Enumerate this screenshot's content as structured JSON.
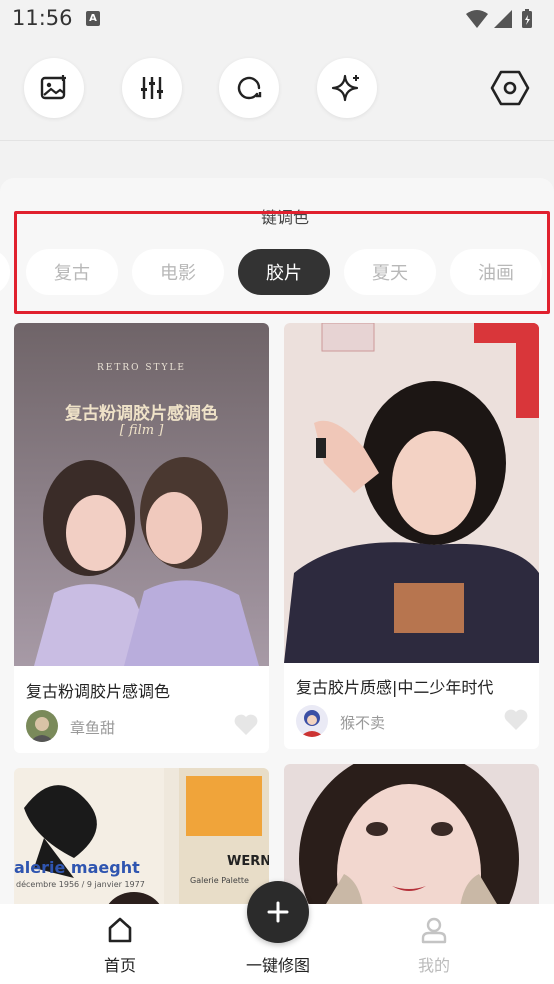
{
  "status_bar": {
    "time": "11:56",
    "notification_icon": "a-icon",
    "icons": [
      "wifi-icon",
      "signal-icon",
      "battery-icon"
    ]
  },
  "tools": [
    {
      "name": "image-icon"
    },
    {
      "name": "sliders-icon"
    },
    {
      "name": "refresh-circle-icon"
    },
    {
      "name": "sparkle-icon"
    }
  ],
  "settings_icon": "hexagon-settings-icon",
  "filter_section": {
    "title": "键调色",
    "chips": [
      "",
      "复古",
      "电影",
      "胶片",
      "夏天",
      "油画"
    ],
    "active_chip": "胶片",
    "highlight_color": "#e0202e"
  },
  "cards": [
    {
      "overlay_title": "复古粉调胶片感调色",
      "overlay_sub": "[ film ]",
      "overlay_top": "RETRO STYLE",
      "title": "复古粉调胶片感调色",
      "author": "章鱼甜"
    },
    {
      "title": "复古胶片质感|中二少年时代",
      "author": "猴不卖"
    },
    {
      "poster_text": "alerie maeght",
      "poster_sub": "décembre 1956 / 9 janvier 1977",
      "poster_text2": "WERNEF",
      "poster_sub2": "Galerie Palette"
    },
    {}
  ],
  "bottom_nav": {
    "home_label": "首页",
    "edit_label": "一键修图",
    "profile_label": "我的"
  },
  "colors": {
    "accent": "#333333",
    "background": "#f2f2f2"
  }
}
